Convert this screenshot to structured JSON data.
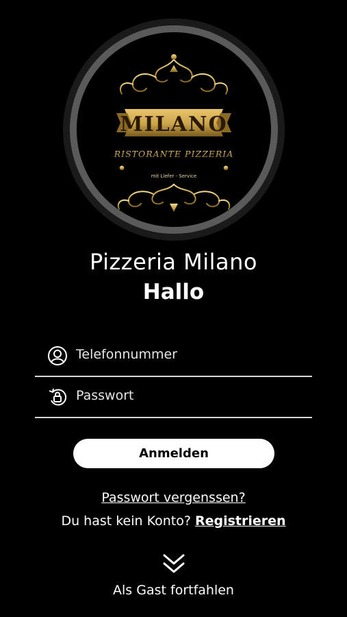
{
  "logo": {
    "brand": "MILANO",
    "subtitle": "RISTORANTE PIZZERIA",
    "tagline": "mit Liefer - Service"
  },
  "header": {
    "restaurant_name": "Pizzeria Milano",
    "greeting": "Hallo"
  },
  "form": {
    "phone": {
      "placeholder": "Telefonnummer",
      "value": "",
      "icon": "user-circle-icon"
    },
    "password": {
      "placeholder": "Passwort",
      "value": "",
      "icon": "lock-reset-icon"
    },
    "login_label": "Anmelden"
  },
  "links": {
    "forgot_password": "Passwort vergenssen?",
    "no_account": "Du hast kein Konto?",
    "register": "Registrieren",
    "guest": "Als Gast fortfahlen",
    "guest_icon": "double-chevron-down-icon"
  },
  "colors": {
    "background": "#000000",
    "text": "#ffffff",
    "button_bg": "#ffffff",
    "button_text": "#000000",
    "gold": "#c9a44a"
  }
}
